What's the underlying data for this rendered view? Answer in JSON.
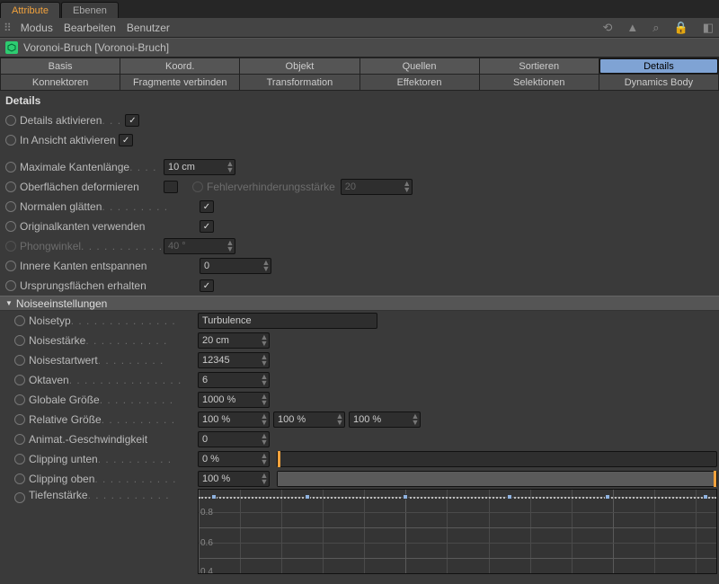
{
  "topTabs": {
    "active": "Attribute",
    "other": "Ebenen"
  },
  "menu": {
    "modus": "Modus",
    "bearbeiten": "Bearbeiten",
    "benutzer": "Benutzer"
  },
  "object": {
    "name": "Voronoi-Bruch [Voronoi-Bruch]"
  },
  "tabs": {
    "row1": [
      "Basis",
      "Koord.",
      "Objekt",
      "Quellen",
      "Sortieren",
      "Details"
    ],
    "row2": [
      "Konnektoren",
      "Fragmente verbinden",
      "Transformation",
      "Effektoren",
      "Selektionen",
      "Dynamics Body"
    ]
  },
  "section": "Details",
  "p": {
    "detailsAktivieren": "Details aktivieren",
    "inAnsichtAktivieren": "In Ansicht aktivieren",
    "maxKanten": "Maximale Kantenlänge",
    "maxKantenVal": "10 cm",
    "oberDeform": "Oberflächen deformieren",
    "fehler": "Fehlerverhinderungsstärke",
    "fehlerVal": "20",
    "normalenGlaetten": "Normalen glätten",
    "originalkanten": "Originalkanten verwenden",
    "phongwinkel": "Phongwinkel",
    "phongVal": "40 °",
    "innereKanten": "Innere Kanten entspannen",
    "innereKantenVal": "0",
    "ursprung": "Ursprungsflächen erhalten",
    "noiseHeader": "Noiseeinstellungen",
    "noisetyp": "Noisetyp",
    "noisetypVal": "Turbulence",
    "noisestaerke": "Noisestärke",
    "noisestaerkeVal": "20 cm",
    "noisestart": "Noisestartwert",
    "noisestartVal": "12345",
    "oktaven": "Oktaven",
    "oktavenVal": "6",
    "globaleGroesse": "Globale Größe",
    "globaleGroesseVal": "1000 %",
    "relativeGroesse": "Relative Größe",
    "relX": "100 %",
    "relY": "100 %",
    "relZ": "100 %",
    "animGeschw": "Animat.-Geschwindigkeit",
    "animGeschwVal": "0",
    "clipUnten": "Clipping unten",
    "clipUntenVal": "0 %",
    "clipOben": "Clipping oben",
    "clipObenVal": "100 %",
    "tiefenstaerke": "Tiefenstärke"
  },
  "graph": {
    "yticks": [
      "0.8",
      "0.6",
      "0.4"
    ]
  }
}
